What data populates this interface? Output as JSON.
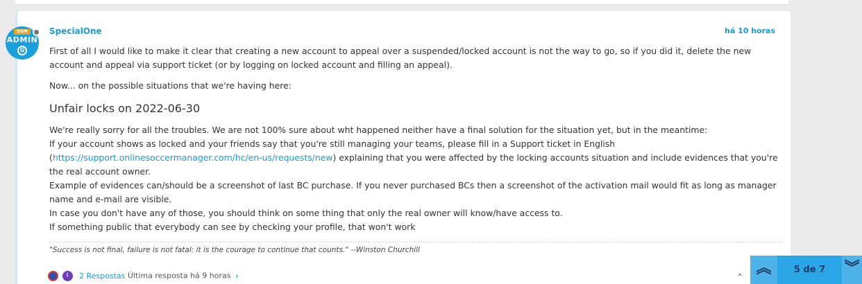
{
  "post": {
    "avatar": {
      "badge": "OSM",
      "label": "ADMIN",
      "logo": "G"
    },
    "username": "SpecialOne",
    "time": "há 10 horas",
    "para1": "First of all I would like to make it clear that creating a new account to appeal over a suspended/locked account is not the way to go, so if you did it, delete the new account and appeal via support ticket (or by logging on locked account and filling an appeal).",
    "para2": "Now... on the possible situations that we're having here:",
    "heading": "Unfair locks on 2022-06-30",
    "line1": "We're really sorry for all the troubles. We are not 100% sure about wht happened neither have a final solution for the situation yet, but in the meantime:",
    "line2": "If your account shows as locked and your friends say that you're still managing your teams, please fill in a Support ticket in English",
    "line3_open": "(",
    "line3_link": "https://support.onlinesoccermanager.com/hc/en-us/requests/new",
    "line3_rest": ") explaining that you were affected by the locking accounts situation and include evidences that you're the real account owner.",
    "line4": "Example of evidences can/should be a screenshot of last BC purchase. If you never purchased BCs then a screenshot of the activation mail would fit as long as manager name and e-mail are visible.",
    "line5": "In case you don't have any of those, you should think on some thing that only the real owner will know/have access to.",
    "line6": "If something public that everybody can see by checking your profile, that won't work",
    "signature": "\"Success is not final, failure is not fatal: it is the courage to continue that counts.\" --Winston Churchill",
    "replies": {
      "avatar2_letter": "I",
      "count_label": "2 Respostas",
      "last_reply": "Última resposta há 9 horas"
    }
  },
  "pager": {
    "label": "5 de 7",
    "current": 5,
    "total": 7
  },
  "icons": {
    "up": "double-chevron-up-icon",
    "down": "double-chevron-down-icon",
    "small_up": "chevron-up-icon",
    "reply_chev": "chevron-right-icon"
  },
  "colors": {
    "link": "#1a9ad6",
    "pager_bg": "#4db3e8",
    "pager_mid": "#2aa5e6",
    "pager_text": "#1d3d66",
    "avatar_bg": "#1aa0dc"
  }
}
